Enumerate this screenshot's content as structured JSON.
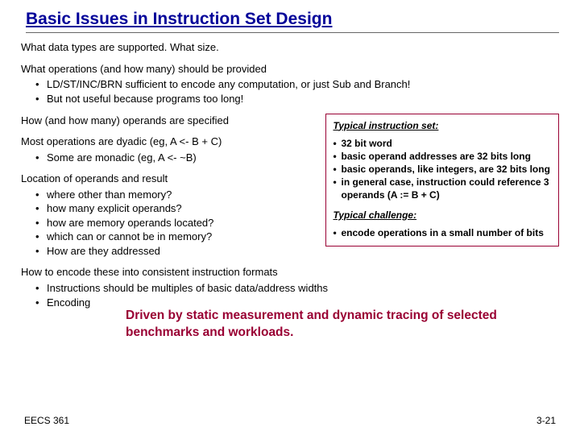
{
  "title": "Basic Issues in Instruction Set Design",
  "p1": "What data types are supported.  What size.",
  "p2_head": "What operations (and how many) should be provided",
  "p2_items": [
    "LD/ST/INC/BRN sufficient to encode any computation, or just Sub and Branch!",
    "But not useful because programs too long!"
  ],
  "left": {
    "p3": "How (and how many) operands are specified",
    "p4_head": "Most operations are dyadic (eg,  A <- B + C)",
    "p4_items": [
      "Some are monadic  (eg, A <- ~B)"
    ],
    "p5_head": "Location of operands and result",
    "p5_items": [
      "where other than memory?",
      "how many explicit operands?",
      "how are memory operands located?",
      "which can or cannot be in memory?",
      "How are they addressed"
    ]
  },
  "box": {
    "head1": "Typical instruction set:",
    "items1": [
      "32 bit word",
      "basic operand addresses are 32 bits long",
      "basic operands, like integers, are 32 bits long",
      "in general case, instruction could reference 3 operands (A := B + C)"
    ],
    "head2": "Typical challenge:",
    "items2": [
      "encode operations in a small number of bits"
    ]
  },
  "p6_head": "How to encode these into consistent instruction formats",
  "p6_items": [
    "Instructions should be multiples of basic data/address widths",
    "Encoding"
  ],
  "driven": "Driven by static measurement and dynamic tracing of selected benchmarks and workloads.",
  "footer_left": "EECS 361",
  "footer_right": "3-21"
}
